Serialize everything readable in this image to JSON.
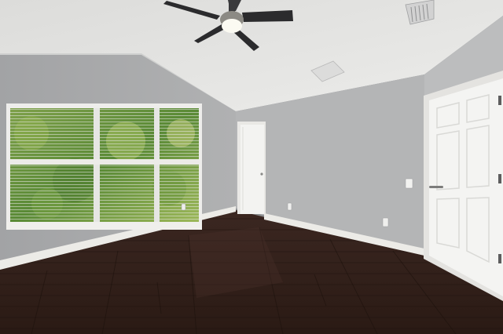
{
  "scene": {
    "colors": {
      "ceiling": "#e6e6e4",
      "ceiling_shadow": "#d2d3d2",
      "wall_left": "#a9aaab",
      "wall_back": "#b6b7b8",
      "wall_right": "#bdbebf",
      "floor": "#3a2520",
      "floor_dark": "#24160f",
      "baseboard": "#eceae6",
      "door": "#f2f2f0",
      "door_frame": "#e9e8e5",
      "fan_blade": "#2c2c2e",
      "foliage": "#5d8a3a",
      "foliage_light": "#9dbb5a",
      "blind": "#e8e8e6",
      "vent": "#cfcfcf"
    },
    "objects": [
      "ceiling-fan",
      "ceiling-light",
      "hvac-vent",
      "window-with-blinds",
      "interior-door",
      "closet-door",
      "hardwood-floor",
      "light-switch",
      "wall-outlets",
      "baseboards"
    ]
  }
}
